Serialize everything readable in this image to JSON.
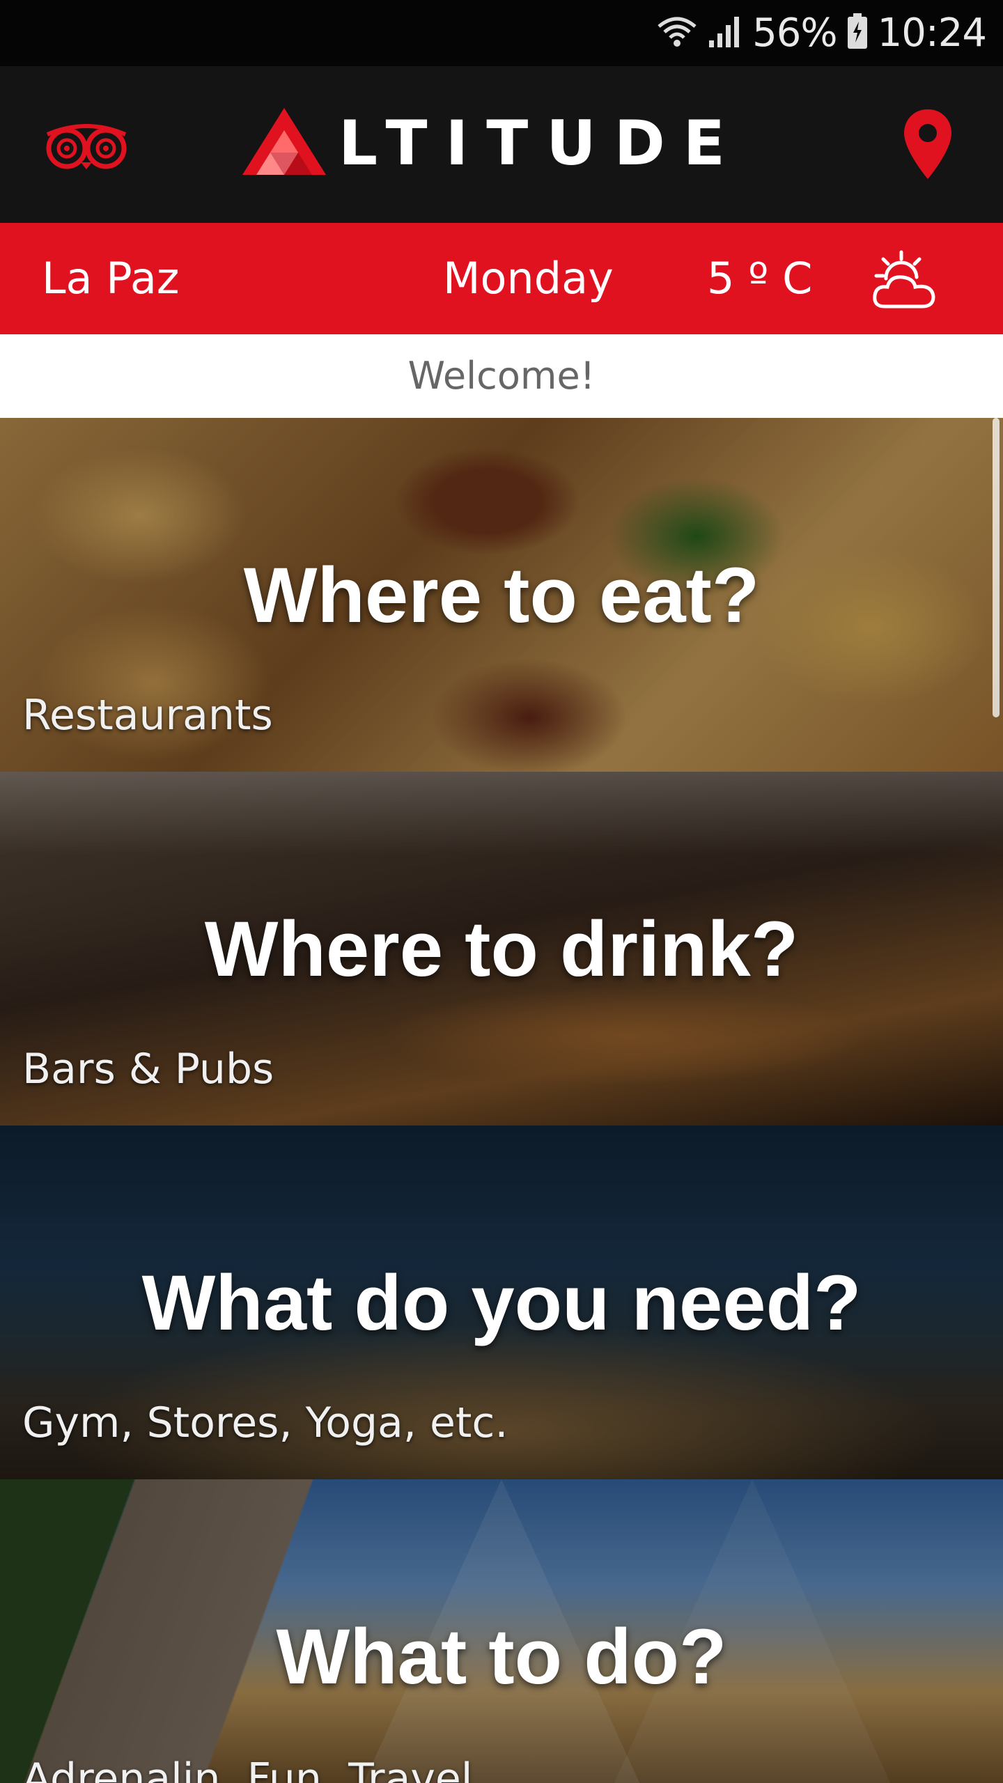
{
  "status_bar": {
    "battery": "56%",
    "time": "10:24",
    "icons": [
      "wifi-icon",
      "signal-icon",
      "battery-icon"
    ]
  },
  "header": {
    "brand_text": "LTITUDE",
    "left_icon": "tripadvisor-owl-icon",
    "right_icon": "location-pin-icon"
  },
  "weather": {
    "city": "La Paz",
    "day": "Monday",
    "temperature": "5 º C",
    "icon": "partly-cloudy-icon"
  },
  "welcome": "Welcome!",
  "categories": [
    {
      "title": "Where to eat?",
      "subtitle": "Restaurants"
    },
    {
      "title": "Where to drink?",
      "subtitle": "Bars & Pubs"
    },
    {
      "title": "What do you need?",
      "subtitle": "Gym, Stores, Yoga, etc."
    },
    {
      "title": "What to do?",
      "subtitle": "Adrenalin, Fun, Travel"
    }
  ],
  "colors": {
    "accent": "#e0121f",
    "header_bg": "#141414",
    "status_bg": "#050505"
  }
}
